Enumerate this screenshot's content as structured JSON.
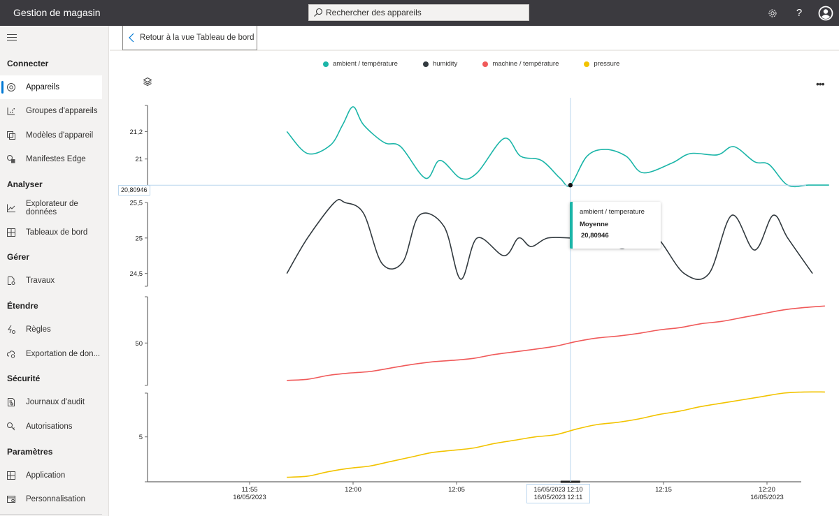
{
  "app": {
    "title": "Gestion de magasin",
    "search_placeholder": "Rechercher des appareils",
    "icons": {
      "settings": "gear-icon",
      "help": "help-icon",
      "account": "account-icon"
    }
  },
  "sidebar": {
    "sections": [
      {
        "title": "Connecter",
        "items": [
          {
            "label": "Appareils",
            "icon": "devices-icon",
            "active": true
          },
          {
            "label": "Groupes d'appareils",
            "icon": "device-groups-icon"
          },
          {
            "label": "Modèles d'appareil",
            "icon": "device-templates-icon"
          },
          {
            "label": "Manifestes Edge",
            "icon": "edge-manifests-icon"
          }
        ]
      },
      {
        "title": "Analyser",
        "items": [
          {
            "label": "Explorateur de données",
            "icon": "data-explorer-icon"
          },
          {
            "label": "Tableaux de bord",
            "icon": "dashboards-icon"
          }
        ]
      },
      {
        "title": "Gérer",
        "items": [
          {
            "label": "Travaux",
            "icon": "jobs-icon"
          }
        ]
      },
      {
        "title": "Étendre",
        "items": [
          {
            "label": "Règles",
            "icon": "rules-icon"
          },
          {
            "label": "Exportation de don...",
            "icon": "data-export-icon"
          }
        ]
      },
      {
        "title": "Sécurité",
        "items": [
          {
            "label": "Journaux d'audit",
            "icon": "audit-logs-icon"
          },
          {
            "label": "Autorisations",
            "icon": "permissions-icon"
          }
        ]
      },
      {
        "title": "Paramètres",
        "items": [
          {
            "label": "Application",
            "icon": "application-icon"
          },
          {
            "label": "Personnalisation",
            "icon": "customization-icon"
          }
        ]
      }
    ]
  },
  "header": {
    "back_label": "Retour à la vue Tableau de bord"
  },
  "tooltip": {
    "series": "ambient / temperature",
    "aggregation": "Moyenne",
    "value": "20,80946",
    "color": "#1bb5a8"
  },
  "hover": {
    "y_value": "20,80946",
    "x_range_start": "16/05/2023 12:10",
    "x_range_end": "16/05/2023 12:11"
  },
  "chart_data": {
    "type": "line",
    "legend_position": "top",
    "legend": [
      {
        "name": "ambient / température",
        "color": "#1bb5a8"
      },
      {
        "name": "humidity",
        "color": "#323a3f"
      },
      {
        "name": "machine / température",
        "color": "#f05a5a"
      },
      {
        "name": "pressure",
        "color": "#f2c300"
      }
    ],
    "x_ticks": [
      {
        "minute": 0,
        "label": "11:55",
        "sublabel": "16/05/2023"
      },
      {
        "minute": 5,
        "label": "12:00",
        "sublabel": ""
      },
      {
        "minute": 10,
        "label": "12:05",
        "sublabel": ""
      },
      {
        "minute": 20,
        "label": "12:15",
        "sublabel": ""
      },
      {
        "minute": 25,
        "label": "12:20",
        "sublabel": "16/05/2023"
      }
    ],
    "x_range_minutes_from_1155": [
      -4.9,
      29.8
    ],
    "x_unit": "minutes since 11:55 16/05/2023",
    "hover_minute": 15.5,
    "panels": [
      {
        "series": "ambient / température",
        "color": "#1bb5a8",
        "y_ticks": [
          {
            "value": 21.2,
            "label": "21,2"
          },
          {
            "value": 21,
            "label": "21"
          }
        ],
        "ylim": [
          20.78,
          21.39
        ],
        "x": [
          1.8,
          2.8,
          3.9,
          4.5,
          5.0,
          5.5,
          6.5,
          7.3,
          8.5,
          9.2,
          10.2,
          11.0,
          12.3,
          13.1,
          14.1,
          15.0,
          15.5,
          16.3,
          17.2,
          18.2,
          19.0,
          20.4,
          21.3,
          22.6,
          23.4,
          24.4,
          25.1,
          26.0,
          27.0,
          28.0
        ],
        "values": [
          21.2,
          21.04,
          21.1,
          21.25,
          21.38,
          21.25,
          21.12,
          21.09,
          20.86,
          20.99,
          20.86,
          20.9,
          21.15,
          21.02,
          20.99,
          20.86,
          20.81,
          21.02,
          21.07,
          21.02,
          20.9,
          20.97,
          21.04,
          21.03,
          21.09,
          20.98,
          20.96,
          20.81,
          20.81,
          20.81
        ]
      },
      {
        "series": "humidity",
        "color": "#323a3f",
        "y_ticks": [
          {
            "value": 25.5,
            "label": "25,5"
          },
          {
            "value": 25,
            "label": "25"
          },
          {
            "value": 24.5,
            "label": "24,5"
          }
        ],
        "ylim": [
          24.32,
          25.5
        ],
        "x": [
          1.8,
          2.8,
          4.1,
          4.6,
          5.5,
          6.4,
          7.4,
          8.2,
          9.4,
          10.2,
          11.0,
          12.3,
          13.0,
          13.6,
          14.4,
          15.5,
          16.0,
          17.2,
          18.0,
          18.8,
          19.7,
          21.0,
          22.2,
          23.3,
          24.4,
          25.3,
          26.0,
          27.2
        ],
        "values": [
          24.5,
          25.0,
          25.5,
          25.5,
          25.35,
          24.64,
          24.66,
          25.32,
          25.16,
          24.42,
          25.0,
          24.75,
          25.0,
          24.88,
          25.0,
          25.0,
          25.0,
          25.0,
          24.85,
          25.0,
          25.0,
          24.5,
          24.5,
          25.32,
          24.83,
          25.32,
          25.0,
          24.5
        ]
      },
      {
        "series": "machine / température",
        "color": "#f05a5a",
        "y_ticks": [
          {
            "value": 50,
            "label": "50"
          }
        ],
        "ylim": [
          39,
          62
        ],
        "x": [
          1.8,
          2.8,
          3.8,
          4.8,
          5.8,
          6.8,
          7.8,
          8.8,
          9.8,
          10.8,
          11.8,
          12.8,
          13.8,
          14.8,
          15.8,
          16.8,
          17.8,
          18.8,
          19.8,
          20.8,
          21.8,
          22.8,
          23.8,
          24.8,
          25.8,
          26.8,
          27.8
        ],
        "values": [
          40.3,
          40.6,
          41.6,
          42.2,
          42.6,
          43.5,
          44.4,
          45.1,
          45.5,
          46.0,
          47.0,
          47.7,
          48.4,
          49.2,
          50.4,
          51.3,
          51.8,
          52.5,
          53.4,
          54.0,
          55.0,
          55.6,
          56.6,
          57.6,
          58.6,
          59.2,
          59.6
        ]
      },
      {
        "series": "pressure",
        "color": "#f2c300",
        "y_ticks": [
          {
            "value": 5,
            "label": "5"
          }
        ],
        "ylim": [
          1.0,
          8.9
        ],
        "x": [
          1.8,
          2.8,
          3.8,
          4.8,
          5.8,
          6.8,
          7.8,
          8.8,
          9.8,
          10.8,
          11.8,
          12.8,
          13.8,
          14.8,
          15.8,
          16.8,
          17.8,
          18.8,
          19.8,
          20.8,
          21.8,
          22.8,
          23.8,
          24.8,
          25.8,
          26.8,
          27.8
        ],
        "values": [
          1.4,
          1.5,
          1.9,
          2.2,
          2.4,
          2.8,
          3.2,
          3.6,
          3.8,
          4.0,
          4.4,
          4.7,
          5.0,
          5.2,
          5.7,
          6.1,
          6.3,
          6.6,
          7.0,
          7.3,
          7.7,
          8.0,
          8.3,
          8.6,
          8.9,
          9.0,
          9.0
        ]
      }
    ]
  }
}
